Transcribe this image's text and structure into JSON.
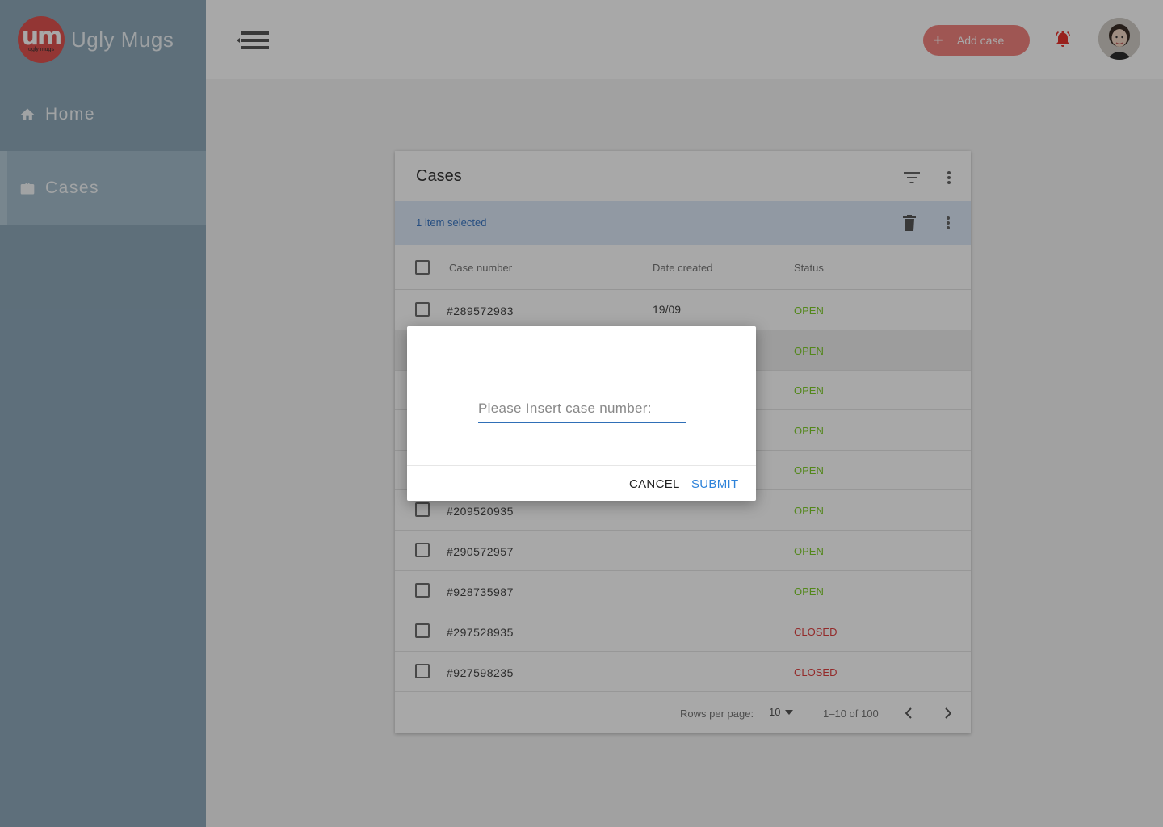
{
  "brand": {
    "logo_text": "um",
    "logo_subtext": "ugly mugs",
    "name": "Ugly Mugs"
  },
  "sidebar": {
    "items": [
      {
        "label": "Home",
        "icon": "home-icon",
        "active": false
      },
      {
        "label": "Cases",
        "icon": "briefcase-icon",
        "active": true
      }
    ]
  },
  "header": {
    "menu_icon": "menu-collapse-icon",
    "add_case_label": "Add case",
    "add_case_icon": "plus-icon",
    "notification_icon": "bell-icon",
    "avatar_icon": "user-avatar"
  },
  "cases_table": {
    "title": "Cases",
    "selection_text": "1 item selected",
    "columns": [
      "Case number",
      "Date created",
      "Status"
    ],
    "rows": [
      {
        "number": "#289572983",
        "date": "19/09",
        "status": "OPEN"
      },
      {
        "number": "",
        "date": "",
        "status": "OPEN"
      },
      {
        "number": "",
        "date": "",
        "status": "OPEN"
      },
      {
        "number": "",
        "date": "",
        "status": "OPEN"
      },
      {
        "number": "",
        "date": "",
        "status": "OPEN"
      },
      {
        "number": "#209520935",
        "date": "",
        "status": "OPEN"
      },
      {
        "number": "#290572957",
        "date": "",
        "status": "OPEN"
      },
      {
        "number": "#928735987",
        "date": "",
        "status": "OPEN"
      },
      {
        "number": "#297528935",
        "date": "",
        "status": "CLOSED"
      },
      {
        "number": "#927598235",
        "date": "",
        "status": "CLOSED"
      }
    ],
    "footer": {
      "rows_per_page_label": "Rows per page:",
      "rows_per_page": "10",
      "range": "1–10 of 100"
    }
  },
  "dialog": {
    "input_placeholder": "Please Insert case number:",
    "input_value": "",
    "cancel_label": "CANCEL",
    "submit_label": "SUBMIT"
  },
  "colors": {
    "sidebar": "#8fa9ba",
    "accent": "#f2837e",
    "open": "#7fcd2a",
    "closed": "#e04141",
    "primary": "#2f6fb7"
  }
}
